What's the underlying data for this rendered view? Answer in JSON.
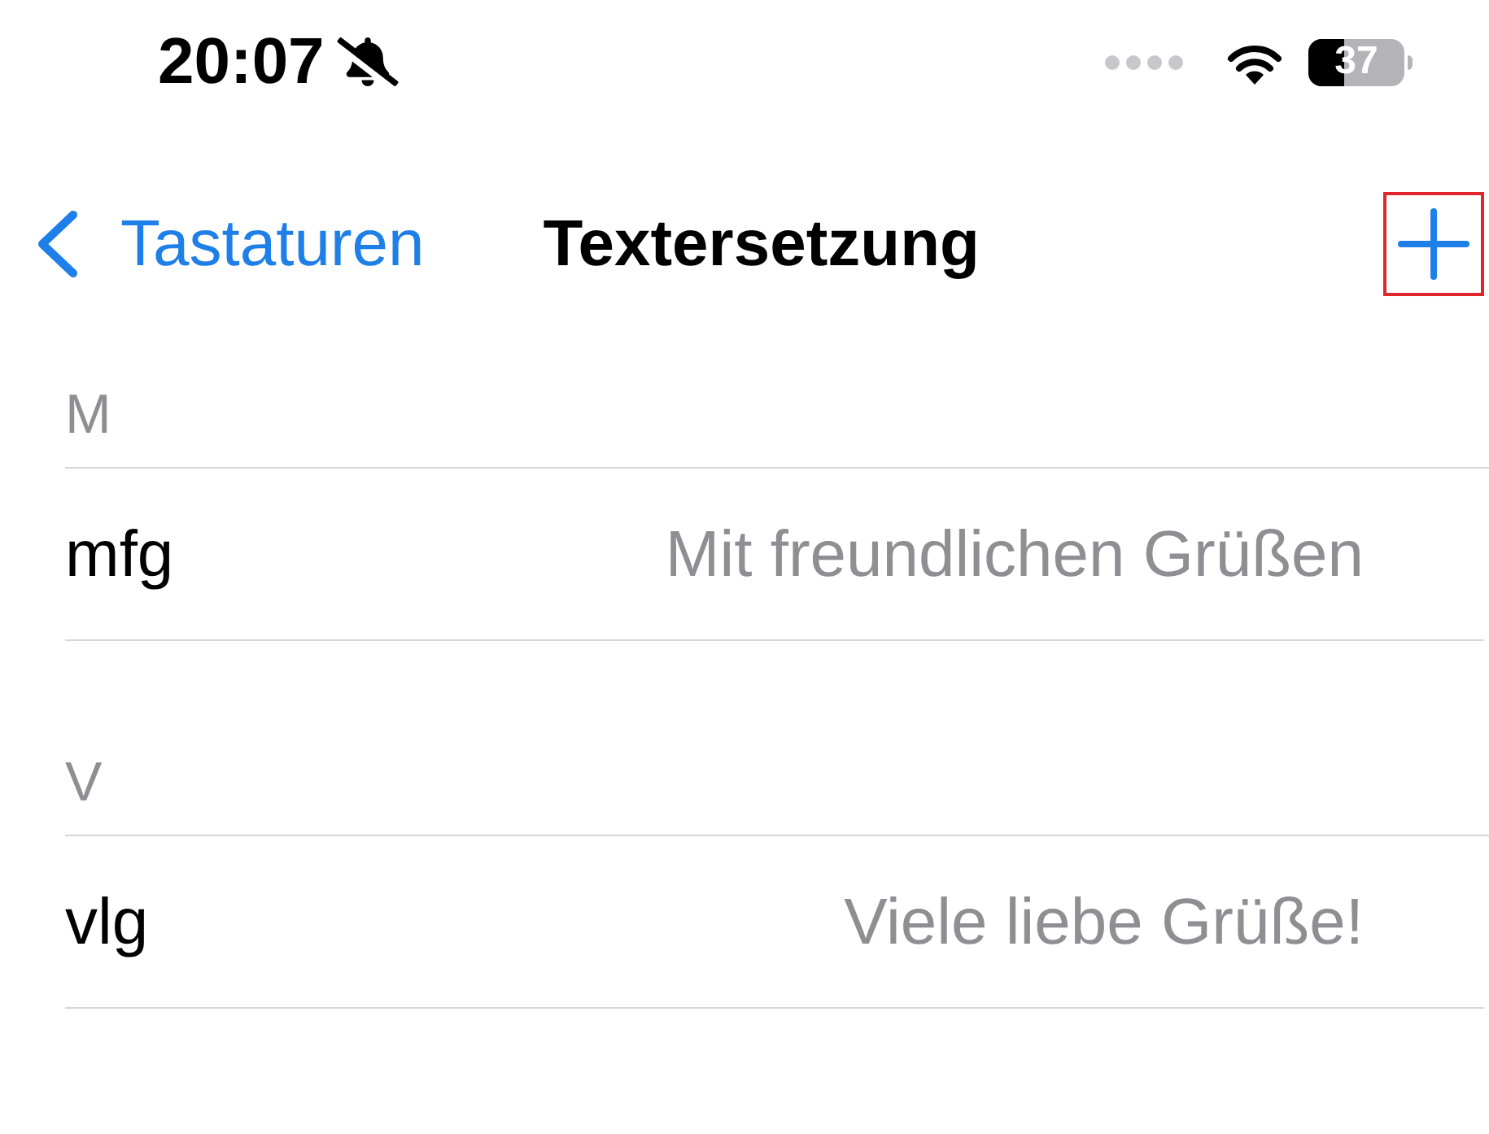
{
  "status_bar": {
    "time": "20:07",
    "silent": true,
    "battery": {
      "level": 0.37,
      "reading": "37"
    }
  },
  "nav": {
    "back": "Tastaturen",
    "title": "Textersetzung",
    "add_button": {
      "highlighted": true
    }
  },
  "sections": [
    {
      "letter": "M",
      "rows": [
        {
          "shortcut": "mfg",
          "phrase": "Mit freundlichen Grüßen"
        }
      ]
    },
    {
      "letter": "V",
      "rows": [
        {
          "shortcut": "vlg",
          "phrase": "Viele liebe Grüße!"
        }
      ]
    }
  ]
}
